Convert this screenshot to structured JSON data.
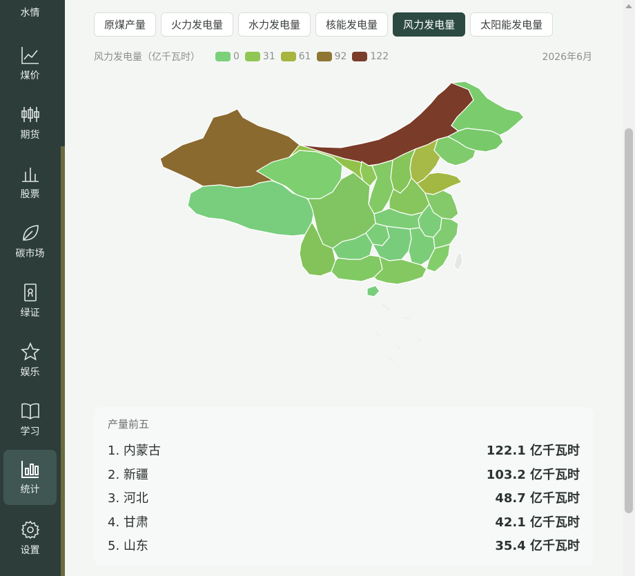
{
  "sidebar": {
    "items": [
      {
        "label": "水情",
        "icon": "water-icon"
      },
      {
        "label": "煤价",
        "icon": "line-chart-icon"
      },
      {
        "label": "期货",
        "icon": "candlestick-icon"
      },
      {
        "label": "股票",
        "icon": "bar-chart-icon"
      },
      {
        "label": "碳市场",
        "icon": "leaf-icon"
      },
      {
        "label": "绿证",
        "icon": "certificate-icon"
      },
      {
        "label": "娱乐",
        "icon": "star-icon"
      },
      {
        "label": "学习",
        "icon": "book-icon"
      },
      {
        "label": "统计",
        "icon": "stats-icon",
        "active": true
      },
      {
        "label": "设置",
        "icon": "gear-icon"
      }
    ]
  },
  "tabs": [
    {
      "label": "原煤产量"
    },
    {
      "label": "火力发电量"
    },
    {
      "label": "水力发电量"
    },
    {
      "label": "核能发电量"
    },
    {
      "label": "风力发电量",
      "active": true
    },
    {
      "label": "太阳能发电量"
    }
  ],
  "legend": {
    "title": "风力发电量（亿千瓦时）",
    "items": [
      {
        "value": "0",
        "color": "#7bd07a"
      },
      {
        "value": "31",
        "color": "#90c656"
      },
      {
        "value": "61",
        "color": "#a6b540"
      },
      {
        "value": "92",
        "color": "#8f7632"
      },
      {
        "value": "122",
        "color": "#7a3d2a"
      }
    ]
  },
  "period": "2026年6月",
  "top5": {
    "title": "产量前五",
    "rows": [
      {
        "rank": "1. 内蒙古",
        "value": "122.1 亿千瓦时"
      },
      {
        "rank": "2. 新疆",
        "value": "103.2 亿千瓦时"
      },
      {
        "rank": "3. 河北",
        "value": "48.7 亿千瓦时"
      },
      {
        "rank": "4. 甘肃",
        "value": "42.1 亿千瓦时"
      },
      {
        "rank": "5. 山东",
        "value": "35.4 亿千瓦时"
      }
    ]
  },
  "colors": {
    "sidebar_bg": "#2d3d3a",
    "active_tab": "#2c4a42",
    "accent_track": "#6c6a3f"
  }
}
